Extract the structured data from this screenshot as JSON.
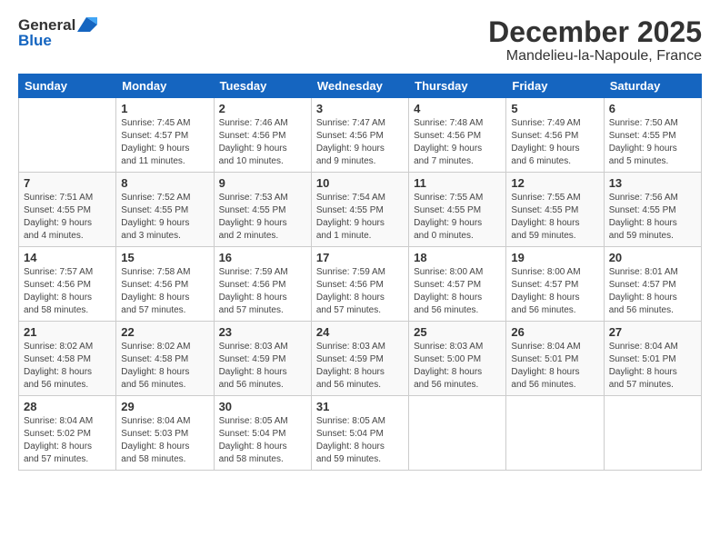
{
  "header": {
    "logo_line1": "General",
    "logo_line2": "Blue",
    "month": "December 2025",
    "location": "Mandelieu-la-Napoule, France"
  },
  "days_of_week": [
    "Sunday",
    "Monday",
    "Tuesday",
    "Wednesday",
    "Thursday",
    "Friday",
    "Saturday"
  ],
  "weeks": [
    [
      {
        "day": "",
        "info": ""
      },
      {
        "day": "1",
        "info": "Sunrise: 7:45 AM\nSunset: 4:57 PM\nDaylight: 9 hours\nand 11 minutes."
      },
      {
        "day": "2",
        "info": "Sunrise: 7:46 AM\nSunset: 4:56 PM\nDaylight: 9 hours\nand 10 minutes."
      },
      {
        "day": "3",
        "info": "Sunrise: 7:47 AM\nSunset: 4:56 PM\nDaylight: 9 hours\nand 9 minutes."
      },
      {
        "day": "4",
        "info": "Sunrise: 7:48 AM\nSunset: 4:56 PM\nDaylight: 9 hours\nand 7 minutes."
      },
      {
        "day": "5",
        "info": "Sunrise: 7:49 AM\nSunset: 4:56 PM\nDaylight: 9 hours\nand 6 minutes."
      },
      {
        "day": "6",
        "info": "Sunrise: 7:50 AM\nSunset: 4:55 PM\nDaylight: 9 hours\nand 5 minutes."
      }
    ],
    [
      {
        "day": "7",
        "info": "Sunrise: 7:51 AM\nSunset: 4:55 PM\nDaylight: 9 hours\nand 4 minutes."
      },
      {
        "day": "8",
        "info": "Sunrise: 7:52 AM\nSunset: 4:55 PM\nDaylight: 9 hours\nand 3 minutes."
      },
      {
        "day": "9",
        "info": "Sunrise: 7:53 AM\nSunset: 4:55 PM\nDaylight: 9 hours\nand 2 minutes."
      },
      {
        "day": "10",
        "info": "Sunrise: 7:54 AM\nSunset: 4:55 PM\nDaylight: 9 hours\nand 1 minute."
      },
      {
        "day": "11",
        "info": "Sunrise: 7:55 AM\nSunset: 4:55 PM\nDaylight: 9 hours\nand 0 minutes."
      },
      {
        "day": "12",
        "info": "Sunrise: 7:55 AM\nSunset: 4:55 PM\nDaylight: 8 hours\nand 59 minutes."
      },
      {
        "day": "13",
        "info": "Sunrise: 7:56 AM\nSunset: 4:55 PM\nDaylight: 8 hours\nand 59 minutes."
      }
    ],
    [
      {
        "day": "14",
        "info": "Sunrise: 7:57 AM\nSunset: 4:56 PM\nDaylight: 8 hours\nand 58 minutes."
      },
      {
        "day": "15",
        "info": "Sunrise: 7:58 AM\nSunset: 4:56 PM\nDaylight: 8 hours\nand 57 minutes."
      },
      {
        "day": "16",
        "info": "Sunrise: 7:59 AM\nSunset: 4:56 PM\nDaylight: 8 hours\nand 57 minutes."
      },
      {
        "day": "17",
        "info": "Sunrise: 7:59 AM\nSunset: 4:56 PM\nDaylight: 8 hours\nand 57 minutes."
      },
      {
        "day": "18",
        "info": "Sunrise: 8:00 AM\nSunset: 4:57 PM\nDaylight: 8 hours\nand 56 minutes."
      },
      {
        "day": "19",
        "info": "Sunrise: 8:00 AM\nSunset: 4:57 PM\nDaylight: 8 hours\nand 56 minutes."
      },
      {
        "day": "20",
        "info": "Sunrise: 8:01 AM\nSunset: 4:57 PM\nDaylight: 8 hours\nand 56 minutes."
      }
    ],
    [
      {
        "day": "21",
        "info": "Sunrise: 8:02 AM\nSunset: 4:58 PM\nDaylight: 8 hours\nand 56 minutes."
      },
      {
        "day": "22",
        "info": "Sunrise: 8:02 AM\nSunset: 4:58 PM\nDaylight: 8 hours\nand 56 minutes."
      },
      {
        "day": "23",
        "info": "Sunrise: 8:03 AM\nSunset: 4:59 PM\nDaylight: 8 hours\nand 56 minutes."
      },
      {
        "day": "24",
        "info": "Sunrise: 8:03 AM\nSunset: 4:59 PM\nDaylight: 8 hours\nand 56 minutes."
      },
      {
        "day": "25",
        "info": "Sunrise: 8:03 AM\nSunset: 5:00 PM\nDaylight: 8 hours\nand 56 minutes."
      },
      {
        "day": "26",
        "info": "Sunrise: 8:04 AM\nSunset: 5:01 PM\nDaylight: 8 hours\nand 56 minutes."
      },
      {
        "day": "27",
        "info": "Sunrise: 8:04 AM\nSunset: 5:01 PM\nDaylight: 8 hours\nand 57 minutes."
      }
    ],
    [
      {
        "day": "28",
        "info": "Sunrise: 8:04 AM\nSunset: 5:02 PM\nDaylight: 8 hours\nand 57 minutes."
      },
      {
        "day": "29",
        "info": "Sunrise: 8:04 AM\nSunset: 5:03 PM\nDaylight: 8 hours\nand 58 minutes."
      },
      {
        "day": "30",
        "info": "Sunrise: 8:05 AM\nSunset: 5:04 PM\nDaylight: 8 hours\nand 58 minutes."
      },
      {
        "day": "31",
        "info": "Sunrise: 8:05 AM\nSunset: 5:04 PM\nDaylight: 8 hours\nand 59 minutes."
      },
      {
        "day": "",
        "info": ""
      },
      {
        "day": "",
        "info": ""
      },
      {
        "day": "",
        "info": ""
      }
    ]
  ]
}
